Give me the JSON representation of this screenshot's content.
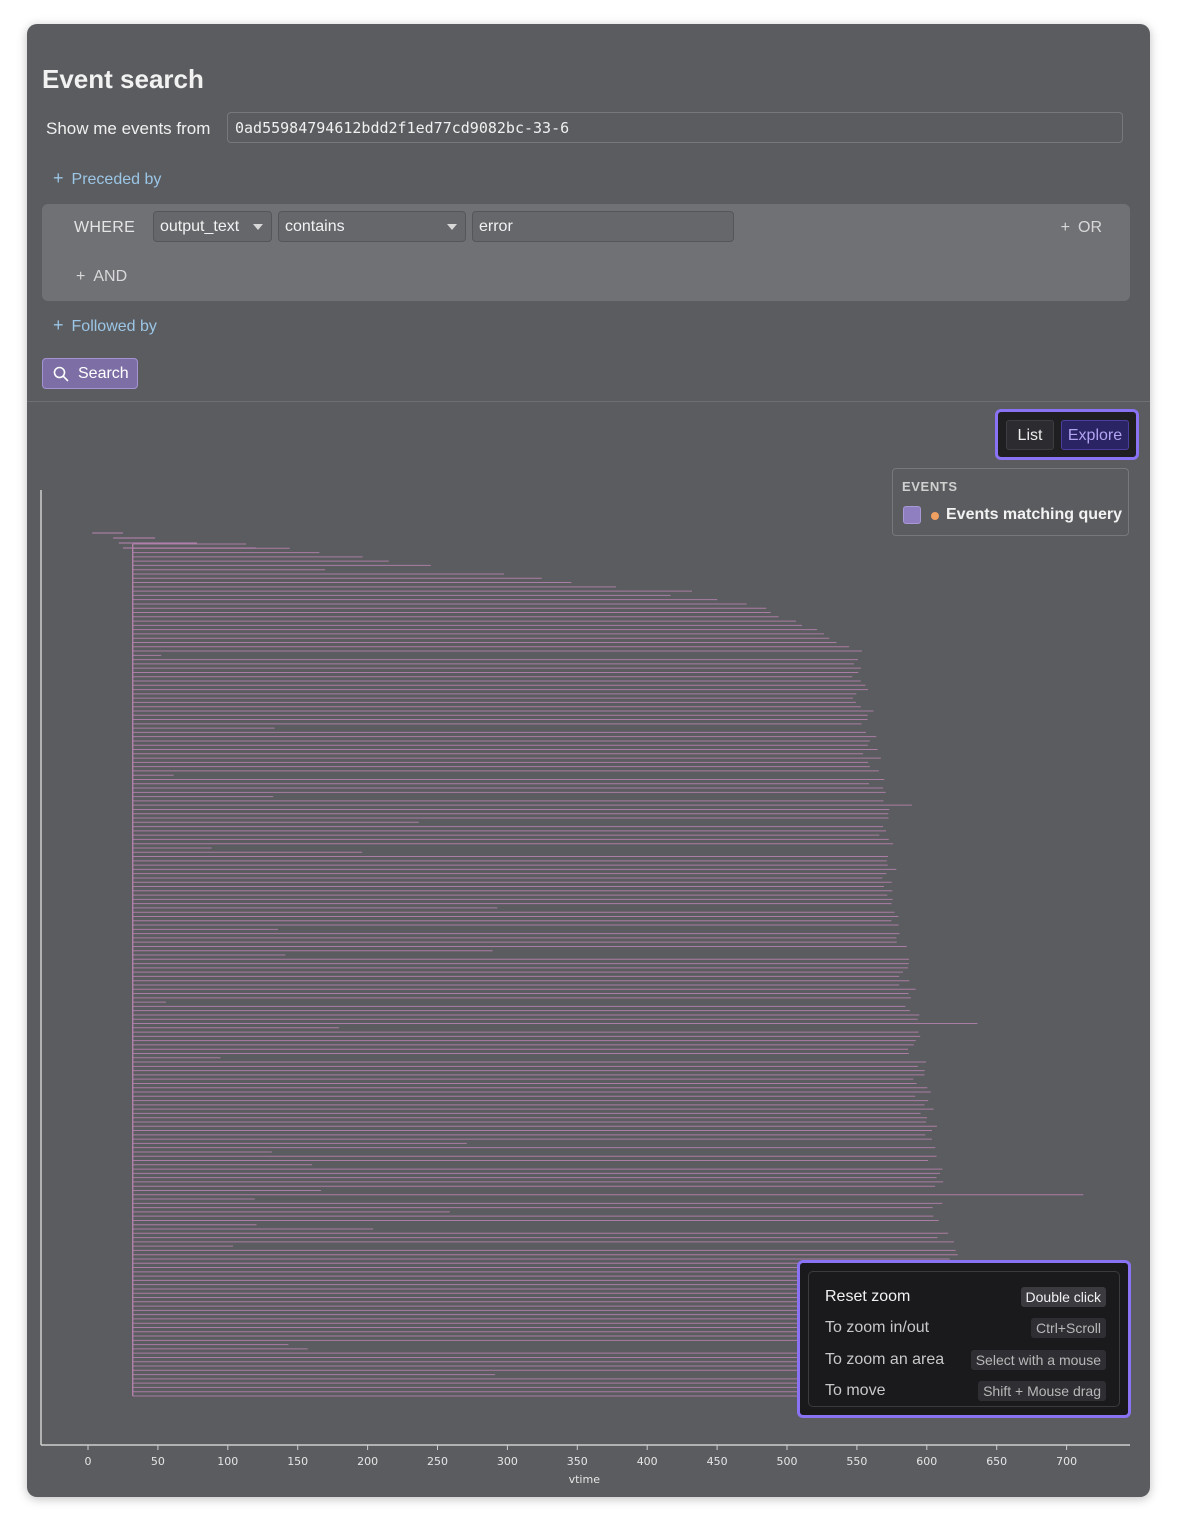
{
  "page": {
    "title": "Event search",
    "show_label": "Show me events from",
    "source_id": "0ad55984794612bdd2f1ed77cd9082bc-33-6"
  },
  "query": {
    "preceded_by": "Preceded by",
    "where_label": "WHERE",
    "field": "output_text",
    "operator": "contains",
    "value": "error",
    "or_label": "OR",
    "and_label": "AND",
    "followed_by": "Followed by",
    "search_label": "Search"
  },
  "view_toggle": {
    "list": "List",
    "explore": "Explore",
    "active": "Explore"
  },
  "legend": {
    "title": "EVENTS",
    "items": [
      {
        "label": "Events matching query",
        "swatch_color": "#8f7ec0",
        "dot_color": "#f0a060"
      }
    ]
  },
  "help": {
    "rows": [
      {
        "action": "Reset zoom",
        "shortcut": "Double click"
      },
      {
        "action": "To zoom in/out",
        "shortcut": "Ctrl+Scroll"
      },
      {
        "action": "To zoom an area",
        "shortcut": "Select with a mouse"
      },
      {
        "action": "To move",
        "shortcut": "Shift + Mouse drag"
      }
    ]
  },
  "colors": {
    "accent": "#8a72f5",
    "event_line": "#b883b0",
    "link": "#9bc6e6"
  },
  "chart_data": {
    "type": "bar",
    "orientation": "horizontal",
    "xlabel": "vtime",
    "xticks": [
      "0",
      "50",
      "100",
      "150",
      "200",
      "250",
      "300",
      "350",
      "400",
      "450",
      "500",
      "550",
      "600",
      "650",
      "700"
    ],
    "xlim": [
      -35,
      745
    ],
    "series": [
      {
        "start": 32,
        "end_min": 40,
        "end_max": 712,
        "count": 200
      }
    ]
  }
}
